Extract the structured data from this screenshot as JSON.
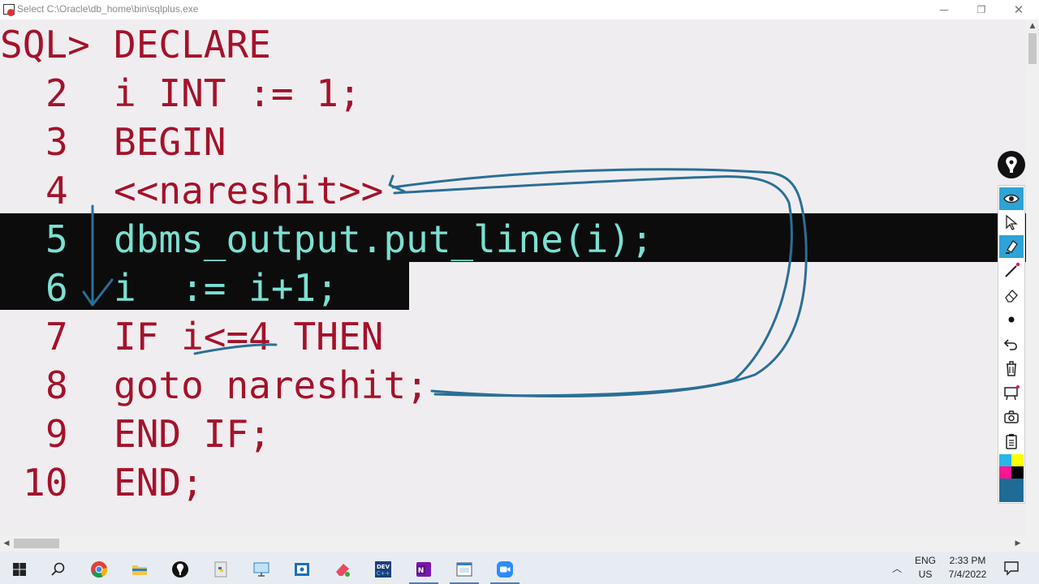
{
  "window": {
    "title": "Select C:\\Oracle\\db_home\\bin\\sqlplus.exe",
    "minimize": "—",
    "maximize": "❐",
    "close": "✕"
  },
  "console": {
    "lines": [
      {
        "num": "SQL>",
        "code": "DECLARE"
      },
      {
        "num": "2",
        "code": "i INT := 1;"
      },
      {
        "num": "3",
        "code": "BEGIN"
      },
      {
        "num": "4",
        "code": "<<nareshit>>"
      },
      {
        "num": "5",
        "code": "dbms_output.put_line(i);"
      },
      {
        "num": "6",
        "code": "i  := i+1;"
      },
      {
        "num": "7",
        "code": "IF i<=4 THEN"
      },
      {
        "num": "8",
        "code": "goto nareshit;"
      },
      {
        "num": "9",
        "code": "END IF;"
      },
      {
        "num": "10",
        "code": "END;"
      }
    ],
    "text_color": "#a4122a",
    "selection_text_color": "#7be0d2",
    "selection_background": "#0c0c0c",
    "background": "#f0edf0",
    "annotation_color": "#2a6f96"
  },
  "pen_toolbar": {
    "tools": [
      "eye-icon",
      "select-arrow-icon",
      "highlighter-icon",
      "pen-icon",
      "eraser-icon",
      "dot-icon",
      "undo-icon",
      "trash-icon",
      "whiteboard-icon",
      "camera-icon",
      "clipboard-icon",
      "color-palette-icon"
    ],
    "active_tools": [
      "eye-icon",
      "highlighter-icon"
    ],
    "palette": [
      "#29b6e8",
      "#ffff00",
      "#ff1493",
      "#000000"
    ],
    "current_color": "#1f6b96"
  },
  "taskbar": {
    "apps": [
      "windows-start-icon",
      "search-icon",
      "chrome-icon",
      "file-explorer-icon",
      "pen-app-icon",
      "python-icon",
      "remote-desktop-icon",
      "screenshot-app-icon",
      "eraser-app-icon",
      "devc-icon",
      "onenote-icon",
      "sqlplus-icon",
      "zoom-icon"
    ],
    "tray_chevron": "︿",
    "language_line1": "ENG",
    "language_line2": "US",
    "time": "2:33 PM",
    "date": "7/4/2022"
  }
}
